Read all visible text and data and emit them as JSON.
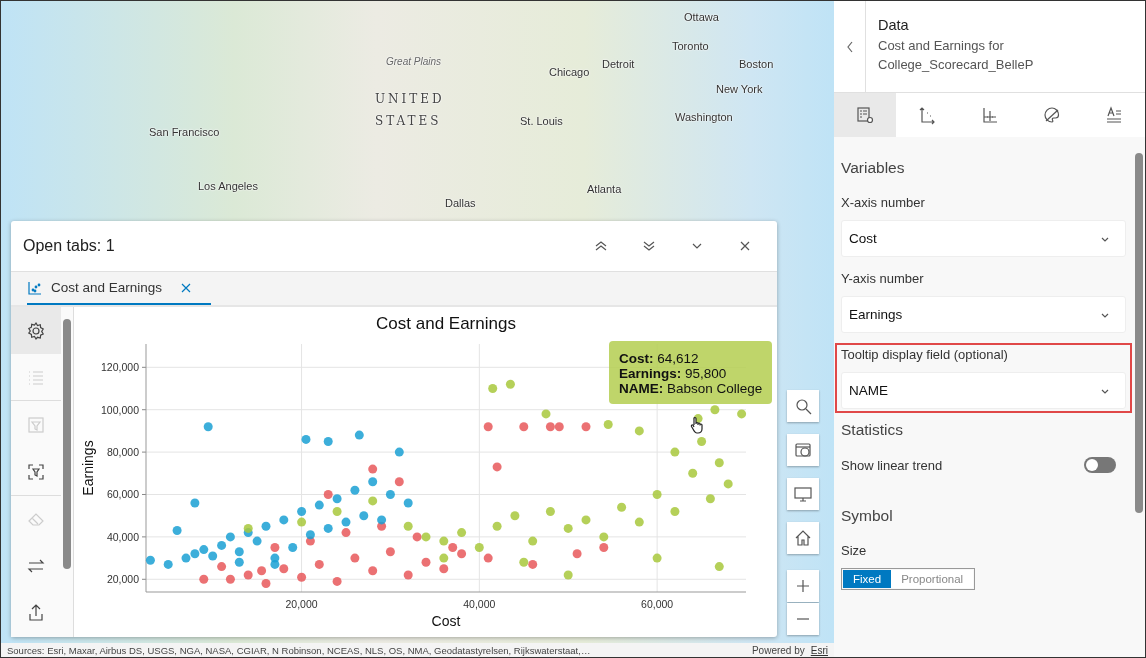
{
  "map": {
    "labels": [
      "Ottawa",
      "Toronto",
      "Great Plains",
      "Detroit",
      "Chicago",
      "Boston",
      "UNITED",
      "New York",
      "STATES",
      "St. Louis",
      "Washington",
      "San Francisco",
      "Los Angeles",
      "Atlanta",
      "Dallas"
    ],
    "attribution": "Sources: Esri, Maxar, Airbus DS, USGS, NGA, NASA, CGIAR, N Robinson, NCEAS, NLS, OS, NMA, Geodatastyrelsen, Rijkswaterstaat,…",
    "powered_by": "Powered by",
    "powered_link": "Esri"
  },
  "chart_panel": {
    "title": "Open tabs: 1",
    "tabs": [
      {
        "label": "Cost and Earnings",
        "selected": true
      }
    ],
    "tools": [
      {
        "kind": "gear",
        "selected": true,
        "disabled": false
      },
      {
        "kind": "list",
        "selected": false,
        "disabled": true
      },
      {
        "kind": "filter",
        "selected": false,
        "disabled": true
      },
      {
        "kind": "select",
        "selected": false,
        "disabled": false
      },
      {
        "kind": "eraser",
        "selected": false,
        "disabled": true
      },
      {
        "kind": "swap",
        "selected": false,
        "disabled": false
      },
      {
        "kind": "export",
        "selected": false,
        "disabled": false
      }
    ],
    "chart_data": {
      "type": "scatter",
      "title": "Cost and Earnings",
      "xlabel": "Cost",
      "ylabel": "Earnings",
      "grid": true,
      "xlim": [
        2500,
        70000
      ],
      "ylim": [
        14000,
        131000
      ],
      "xticks": [
        {
          "value": 20000,
          "label": "20,000"
        },
        {
          "value": 40000,
          "label": "40,000"
        },
        {
          "value": 60000,
          "label": "60,000"
        }
      ],
      "yticks": [
        {
          "value": 20000,
          "label": "20,000"
        },
        {
          "value": 40000,
          "label": "40,000"
        },
        {
          "value": 60000,
          "label": "60,000"
        },
        {
          "value": 80000,
          "label": "80,000"
        },
        {
          "value": 100000,
          "label": "100,000"
        },
        {
          "value": 120000,
          "label": "120,000"
        }
      ],
      "series": [
        {
          "color": "#e8585a",
          "x": [
            12000,
            14000,
            16000,
            18000,
            20000,
            22000,
            24000,
            26000,
            28000,
            30000,
            32000,
            34000,
            36000,
            38000,
            15500,
            17000,
            21000,
            25000,
            29000,
            33000,
            37000,
            41000,
            46000,
            51000,
            54000,
            9000,
            11000,
            23000,
            28000,
            31000,
            41000,
            45000,
            48000,
            49000,
            52000,
            42000
          ],
          "values": [
            20000,
            22000,
            18000,
            25000,
            21000,
            27000,
            19000,
            30000,
            24000,
            33000,
            22000,
            28000,
            25000,
            32000,
            24000,
            35000,
            38000,
            42000,
            45000,
            40000,
            35000,
            30000,
            27000,
            32000,
            35000,
            20000,
            26000,
            60000,
            72000,
            66000,
            92000,
            92000,
            92000,
            92000,
            92000,
            73000
          ]
        },
        {
          "color": "#1aa0d3",
          "x": [
            3000,
            5000,
            7000,
            8000,
            9000,
            10000,
            11000,
            12000,
            13000,
            14000,
            15000,
            16000,
            17000,
            18000,
            19000,
            20000,
            21000,
            22000,
            23000,
            24000,
            25000,
            26000,
            27000,
            28000,
            29000,
            30000,
            31000,
            8000,
            9500,
            20500,
            23000,
            26500,
            6000,
            32000,
            13000,
            17000
          ],
          "values": [
            29000,
            27000,
            30000,
            32000,
            34000,
            31000,
            36000,
            40000,
            33000,
            42000,
            38000,
            45000,
            30000,
            48000,
            35000,
            52000,
            41000,
            55000,
            44000,
            58000,
            47000,
            62000,
            50000,
            66000,
            48000,
            60000,
            80000,
            56000,
            92000,
            86000,
            85000,
            88000,
            43000,
            56000,
            28000,
            27000
          ]
        },
        {
          "color": "#a8c83c",
          "x": [
            14000,
            20000,
            24000,
            28000,
            32000,
            34000,
            36000,
            38000,
            40000,
            42000,
            44000,
            46000,
            48000,
            50000,
            52000,
            54000,
            56000,
            58000,
            60000,
            62000,
            64000,
            66000,
            68000,
            62000,
            65000,
            67000,
            41500,
            43500,
            47500,
            54500,
            58000,
            66500,
            69500,
            64612,
            60000,
            67000,
            45000,
            50000,
            36000
          ],
          "values": [
            44000,
            47000,
            52000,
            57000,
            45000,
            40000,
            38000,
            42000,
            35000,
            45000,
            50000,
            38000,
            52000,
            44000,
            48000,
            40000,
            54000,
            47000,
            60000,
            52000,
            70000,
            58000,
            65000,
            80000,
            85000,
            75000,
            110000,
            112000,
            98000,
            93000,
            90000,
            100000,
            98000,
            95800,
            30000,
            26000,
            28000,
            22000,
            30000
          ]
        }
      ]
    },
    "tooltip": {
      "lines": [
        {
          "key": "Cost:",
          "value": "64,612"
        },
        {
          "key": "Earnings:",
          "value": "95,800"
        },
        {
          "key": "NAME:",
          "value": "Babson College"
        }
      ]
    }
  },
  "side_panel": {
    "title": "Data",
    "subtitle": "Cost and Earnings for College_Scorecard_BelleP",
    "tabs": [
      {
        "kind": "data",
        "selected": true
      },
      {
        "kind": "axes",
        "selected": false
      },
      {
        "kind": "guides",
        "selected": false
      },
      {
        "kind": "palette",
        "selected": false
      },
      {
        "kind": "text",
        "selected": false
      }
    ],
    "sections": [
      {
        "heading": "Variables",
        "items": [
          {
            "kind": "select",
            "label": "X-axis number",
            "value": "Cost",
            "highlighted": false
          },
          {
            "kind": "select",
            "label": "Y-axis number",
            "value": "Earnings",
            "highlighted": false
          },
          {
            "kind": "select",
            "label": "Tooltip display field (optional)",
            "value": "NAME",
            "highlighted": true
          }
        ]
      },
      {
        "heading": "Statistics",
        "items": [
          {
            "kind": "toggle",
            "label": "Show linear trend",
            "on": false
          }
        ]
      },
      {
        "heading": "Symbol",
        "items": [
          {
            "kind": "segmented",
            "label": "Size",
            "options": [
              {
                "label": "Fixed",
                "selected": true
              },
              {
                "label": "Proportional",
                "selected": false
              }
            ]
          }
        ]
      }
    ]
  }
}
